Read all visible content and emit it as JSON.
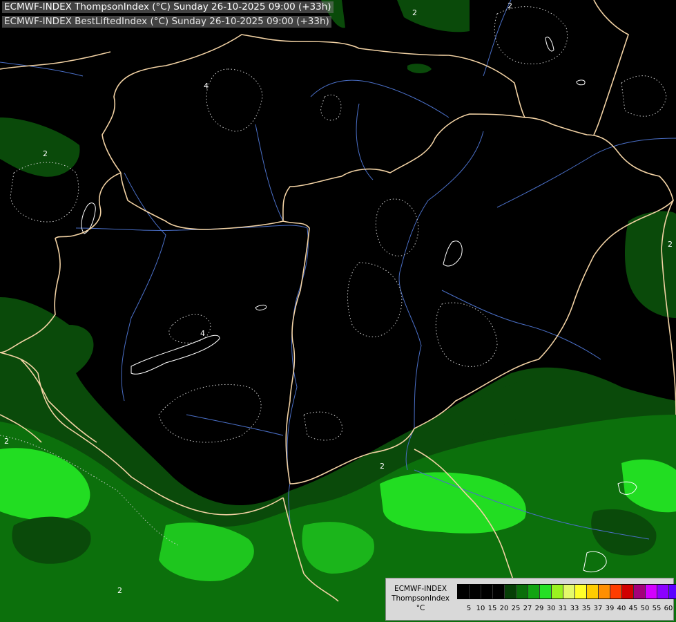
{
  "titles": {
    "line1": "ECMWF-INDEX ThompsonIndex (°C) Sunday 26-10-2025 09:00 (+33h)",
    "line2": "ECMWF-INDEX BestLiftedIndex (°C) Sunday 26-10-2025 09:00 (+33h)"
  },
  "legend": {
    "line1": "ECMWF-INDEX",
    "line2": "ThompsonIndex",
    "line3": "°C",
    "ticks": [
      "5",
      "10",
      "15",
      "20",
      "25",
      "27",
      "29",
      "30",
      "31",
      "33",
      "35",
      "37",
      "39",
      "40",
      "45",
      "50",
      "55",
      "60"
    ],
    "colors": [
      "#000000",
      "#000000",
      "#000000",
      "#000000",
      "#063f06",
      "#0a6e0a",
      "#11a411",
      "#26e026",
      "#9af21f",
      "#e4f96b",
      "#ffff2a",
      "#ffcc00",
      "#ff8f00",
      "#ff3d00",
      "#d10000",
      "#a3007a",
      "#d400ff",
      "#8c00ff",
      "#5a00ff",
      "#0026ff"
    ]
  },
  "contour_labels": [
    "2",
    "4",
    "2",
    "2",
    "4",
    "2",
    "2",
    "2",
    "2"
  ],
  "colors": {
    "background": "#000000",
    "border": "#f2d2a4",
    "river": "#4a6fc7",
    "dark_green": "#0a4a0a",
    "mid_green": "#0f8f0f",
    "bright_green": "#22dd22"
  }
}
